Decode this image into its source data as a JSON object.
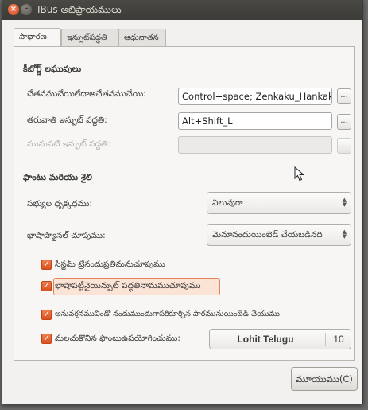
{
  "window": {
    "title": "IBus అభిప్రాయములు"
  },
  "tabs": [
    {
      "label": "సాధారణ"
    },
    {
      "label": "ఇన్పుట్‌పద్ధతి"
    },
    {
      "label": "ఆధునాతన"
    }
  ],
  "shortcuts": {
    "heading": "కీబోర్డ్ లఘువులు",
    "toggle_label": "చేతనముచేయిలేదాఅచేతనముచేయి:",
    "toggle_value": "Control+space; Zenkaku_Hankaku",
    "next_label": "తరువాతి ఇన్పుట్ పద్ధతి:",
    "next_value": "Alt+Shift_L",
    "prev_label": "మునుపటి ఇన్పుట్ పద్ధతి:",
    "prev_value": "",
    "dots": "..."
  },
  "font_style": {
    "heading": "ఫాంటు మరియు శైలి",
    "candidates_label": "సభ్యుల ధృక్కధము:",
    "candidates_value": "నిలువుగా",
    "panel_label": "భాషాప్యానల్ చూపుము:",
    "panel_value": "మెనూనందుయింబెడ్ చేయబడినది"
  },
  "checks": [
    {
      "label": "సిస్టమ్ ట్రేనందుప్రతిమనుచూపుము",
      "checked": true
    },
    {
      "label": "భాషాపట్టీనైయిన్పుట్ పద్ధతినామముచూపుము",
      "checked": true
    },
    {
      "label": "అనువర్తనమువిండో నందుముందుగాసరికూర్చిన పాఠమునుయింబెడ్ చేయుము",
      "checked": true
    },
    {
      "label": "మలచుకొనిన ఫాంటుఉపయోగించుము:",
      "checked": true
    }
  ],
  "custom_font": {
    "name": "Lohit Telugu",
    "size": "10"
  },
  "footer": {
    "close_label": "మూయుము(C)"
  },
  "colors": {
    "accent": "#dd4814",
    "titlebar": "#3c3b37"
  }
}
